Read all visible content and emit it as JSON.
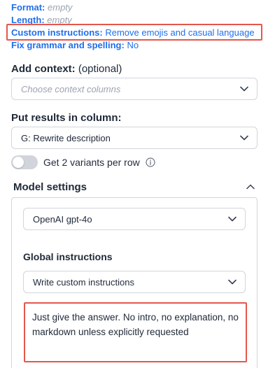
{
  "summary": {
    "format_key": "Format:",
    "format_value": "empty",
    "length_key": "Length:",
    "length_value": "empty",
    "custom_key": "Custom instructions:",
    "custom_value": "Remove emojis and casual language",
    "grammar_key": "Fix grammar and spelling:",
    "grammar_value": "No"
  },
  "context": {
    "label": "Add context:",
    "optional": "(optional)",
    "placeholder": "Choose context columns"
  },
  "results": {
    "label": "Put results in column:",
    "value": "G: Rewrite description"
  },
  "variants": {
    "label": "Get 2 variants per row",
    "enabled": false
  },
  "model_settings": {
    "title": "Model settings",
    "model_value": "OpenAI gpt-4o",
    "global_label": "Global instructions",
    "instructions_select": "Write custom instructions",
    "instructions_text": "Just give the answer. No intro, no explanation, no markdown unless explicitly requested"
  },
  "colors": {
    "link_blue": "#1f6feb",
    "highlight_red": "#e4574c"
  }
}
